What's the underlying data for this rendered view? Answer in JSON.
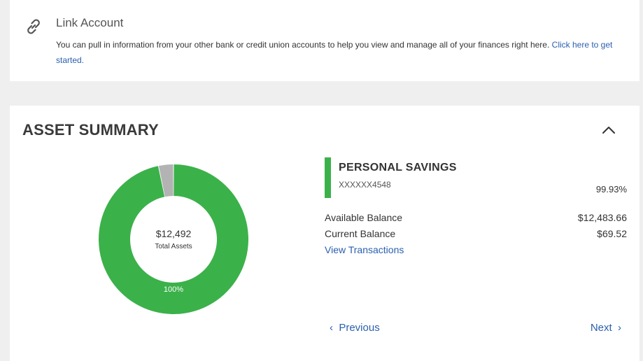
{
  "link_account": {
    "icon": "link-icon",
    "title": "Link Account",
    "description": "You can pull in information from your other bank or credit union accounts to help you view and manage all of your finances right here.",
    "cta": "Click here to get started."
  },
  "asset_summary": {
    "title": "ASSET SUMMARY",
    "collapse_icon": "chevron-up-icon",
    "chart_data": {
      "type": "pie",
      "center_value": "$12,492",
      "center_label": "Total Assets",
      "slices": [
        {
          "name": "PERSONAL SAVINGS",
          "fraction": 0.9677,
          "color": "#3bb14a",
          "label": "100%"
        },
        {
          "name": "other",
          "fraction": 0.0323,
          "color": "#b3b3b3"
        }
      ]
    },
    "account": {
      "name": "PERSONAL SAVINGS",
      "number": "XXXXXX4548",
      "percentage": "99.93%",
      "color": "#3bb14a",
      "available_label": "Available Balance",
      "available_value": "$12,483.66",
      "current_label": "Current Balance",
      "current_value": "$69.52",
      "view_link": "View Transactions"
    },
    "pager": {
      "previous": "Previous",
      "next": "Next"
    }
  }
}
